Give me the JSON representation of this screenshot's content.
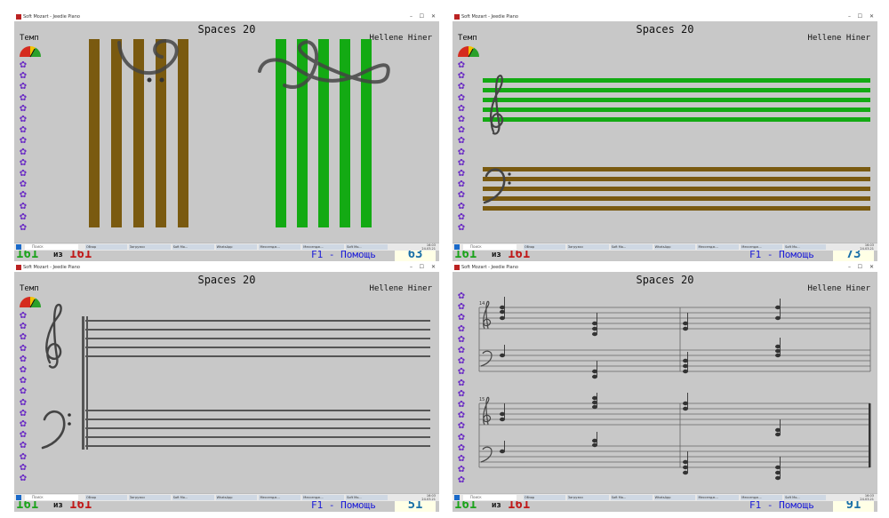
{
  "window": {
    "title": "Soft Mozart - Jeedie Piano",
    "controls": [
      "–",
      "☐",
      "✕"
    ]
  },
  "lesson_title": "Spaces 20",
  "author": "Hellene Hiner",
  "tempo_label": "Темп",
  "counter": {
    "current": "161",
    "of_label": "из",
    "total": "161"
  },
  "help_text": "F1 - Помощь",
  "screens": [
    {
      "score": "63"
    },
    {
      "score": "73"
    },
    {
      "score": "51"
    },
    {
      "score": "91"
    }
  ],
  "taskbar": {
    "search_placeholder": "Поиск",
    "apps": [
      "Обзор",
      "Загрузки",
      "Soft Mo...",
      "WhatsApp",
      "Мессендж...",
      "Мессендж...",
      "Soft Mo..."
    ],
    "clock_time": "16:03",
    "clock_date": "24.03.21"
  },
  "colors": {
    "brown_stave": "#7a5a10",
    "green_stave": "#13aa13",
    "flower": "#6a2bc4",
    "count_green": "#1aa31a",
    "count_red": "#c01818",
    "help_blue": "#1a1ad8",
    "score_blue": "#1a6fa8"
  }
}
